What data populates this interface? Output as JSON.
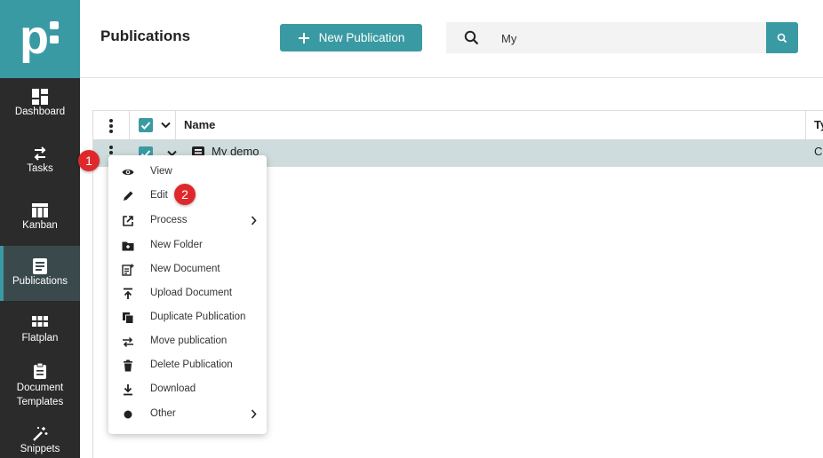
{
  "app": {
    "logo_text": "p:"
  },
  "sidebar": {
    "items": [
      {
        "label": "Dashboard",
        "icon": "dashboard-icon"
      },
      {
        "label": "Tasks",
        "icon": "swap-arrows-icon"
      },
      {
        "label": "Kanban",
        "icon": "kanban-icon"
      },
      {
        "label": "Publications",
        "icon": "document-icon",
        "active": true
      },
      {
        "label": "Flatplan",
        "icon": "grid-icon"
      },
      {
        "label": "Document Templates",
        "icon": "clipboard-icon"
      },
      {
        "label": "Snippets",
        "icon": "magic-wand-icon"
      }
    ]
  },
  "header": {
    "title": "Publications",
    "new_button": "New Publication",
    "search_value": "My"
  },
  "table": {
    "columns": [
      "Name",
      "Ty"
    ],
    "rows": [
      {
        "name": "My demo",
        "type": "C"
      }
    ]
  },
  "context_menu": {
    "items": [
      {
        "label": "View",
        "icon": "eye-icon"
      },
      {
        "label": "Edit",
        "icon": "pencil-icon"
      },
      {
        "label": "Process",
        "icon": "external-link-icon",
        "submenu": true
      },
      {
        "label": "New Folder",
        "icon": "folder-plus-icon"
      },
      {
        "label": "New Document",
        "icon": "document-plus-icon"
      },
      {
        "label": "Upload Document",
        "icon": "upload-icon"
      },
      {
        "label": "Duplicate Publication",
        "icon": "duplicate-icon"
      },
      {
        "label": "Move publication",
        "icon": "move-arrows-icon"
      },
      {
        "label": "Delete Publication",
        "icon": "trash-icon"
      },
      {
        "label": "Download",
        "icon": "download-icon"
      },
      {
        "label": "Other",
        "icon": "circle-icon",
        "submenu": true
      }
    ]
  },
  "annotations": {
    "badge1": "1",
    "badge2": "2"
  },
  "colors": {
    "accent": "#3a9aa3",
    "sidebar_bg": "#2b2b2b",
    "badge": "#e0282b",
    "row_selected": "#cfdcdd"
  }
}
